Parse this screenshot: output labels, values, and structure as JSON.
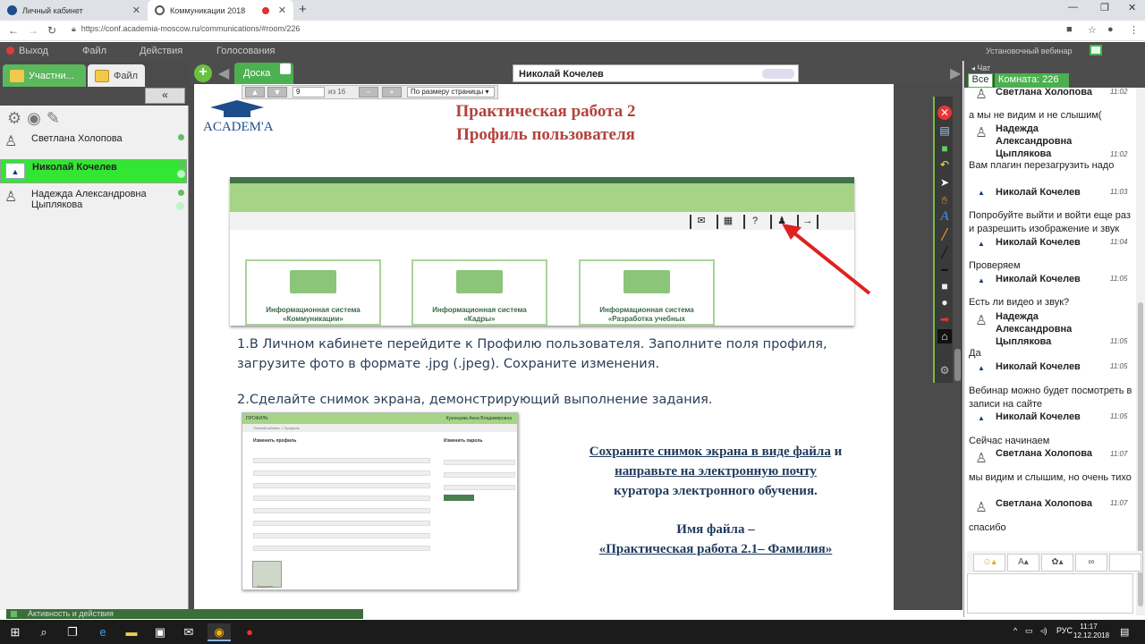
{
  "browser": {
    "tabs": [
      {
        "title": "Личный кабинет"
      },
      {
        "title": "Коммуникации 2018"
      }
    ],
    "url": "https://conf.academia-moscow.ru/communications/#room/226"
  },
  "app": {
    "menu": {
      "exit": "Выход",
      "file": "Файл",
      "actions": "Действия",
      "voting": "Голосования"
    },
    "webinar_title": "Установочный вебинар"
  },
  "left_panel": {
    "tabs": {
      "participants": "Участни...",
      "file": "Файл"
    },
    "collapse": "«",
    "participants": [
      {
        "name": "Светлана Холопова"
      },
      {
        "name": "Николай Кочелев"
      },
      {
        "name": "Надежда Александровна Цыплякова"
      }
    ],
    "activity": "Активность и действия"
  },
  "board": {
    "tab_label": "Доска",
    "presenter": "Николай Кочелев",
    "page_current": "9",
    "page_of": "из 16",
    "zoom_select": "По размеру страницы"
  },
  "document": {
    "logo_text": "ACADEM'A",
    "title_line1": "Практическая работа 2",
    "title_line2": "Профиль пользователя",
    "cards": [
      {
        "line1": "Информационная система",
        "line2": "«Коммуникации»"
      },
      {
        "line1": "Информационная система",
        "line2": "«Кадры»"
      },
      {
        "line1": "Информационная система",
        "line2": "«Разработка учебных"
      }
    ],
    "step1": "1.В Личном кабинете перейдите к Профилю пользователя. Заполните поля профиля, загрузите фото в формате .jpg (.jpeg). Сохраните изменения.",
    "step2": "2.Сделайте снимок экрана, демонстрирующий выполнение задания.",
    "save_line1_u": "Сохраните снимок экрана в виде файла",
    "save_line1_rest": " и",
    "save_line2_u": "направьте на электронную почту",
    "save_line3": "куратора электронного обучения.",
    "filename_label": "Имя файла –",
    "filename_value": "«Практическая работа 2.1– Фамилия»",
    "form_shot": {
      "header_left": "ПРОФИЛЬ",
      "header_right": "Кузнецова Анна Владимировна",
      "crumb": "Личный кабинет > Профиль",
      "edit_profile": "Изменить профиль",
      "change_password": "Изменить пароль",
      "upload": "Загрузить"
    }
  },
  "chat": {
    "label": "Чат",
    "all": "Все",
    "room": "Комната: 226",
    "messages": [
      {
        "name": "Светлана Холопова",
        "time": "11:02",
        "text": "а мы не видим и не слышим("
      },
      {
        "name": "Надежда Александровна Цыплякова",
        "time": "11:02",
        "text": "Вам плагин перезагрузить надо"
      },
      {
        "name": "Николай Кочелев",
        "time": "11:03",
        "text": "Попробуйте выйти и войти еще раз и разрешить изображение и звук"
      },
      {
        "name": "Николай Кочелев",
        "time": "11:04",
        "text": "Проверяем"
      },
      {
        "name": "Николай Кочелев",
        "time": "11:05",
        "text": "Есть ли видео и звук?"
      },
      {
        "name": "Надежда Александровна Цыплякова",
        "time": "11:05",
        "text": "Да"
      },
      {
        "name": "Николай Кочелев",
        "time": "11:05",
        "text": "Вебинар можно будет посмотреть в записи на сайте"
      },
      {
        "name": "Николай Кочелев",
        "time": "11:05",
        "text": "Сейчас начинаем"
      },
      {
        "name": "Светлана Холопова",
        "time": "11:07",
        "text": "мы видим и слышим, но очень тихо"
      },
      {
        "name": "Светлана Холопова",
        "time": "11:07",
        "text": "спасибо"
      }
    ]
  },
  "taskbar": {
    "lang": "РУС",
    "time": "11:17",
    "date": "12.12.2018"
  },
  "colors": {
    "accent_green": "#4caf50",
    "active_participant": "#33e633",
    "title_red": "#b2433d",
    "arrow_red": "#e02020"
  }
}
